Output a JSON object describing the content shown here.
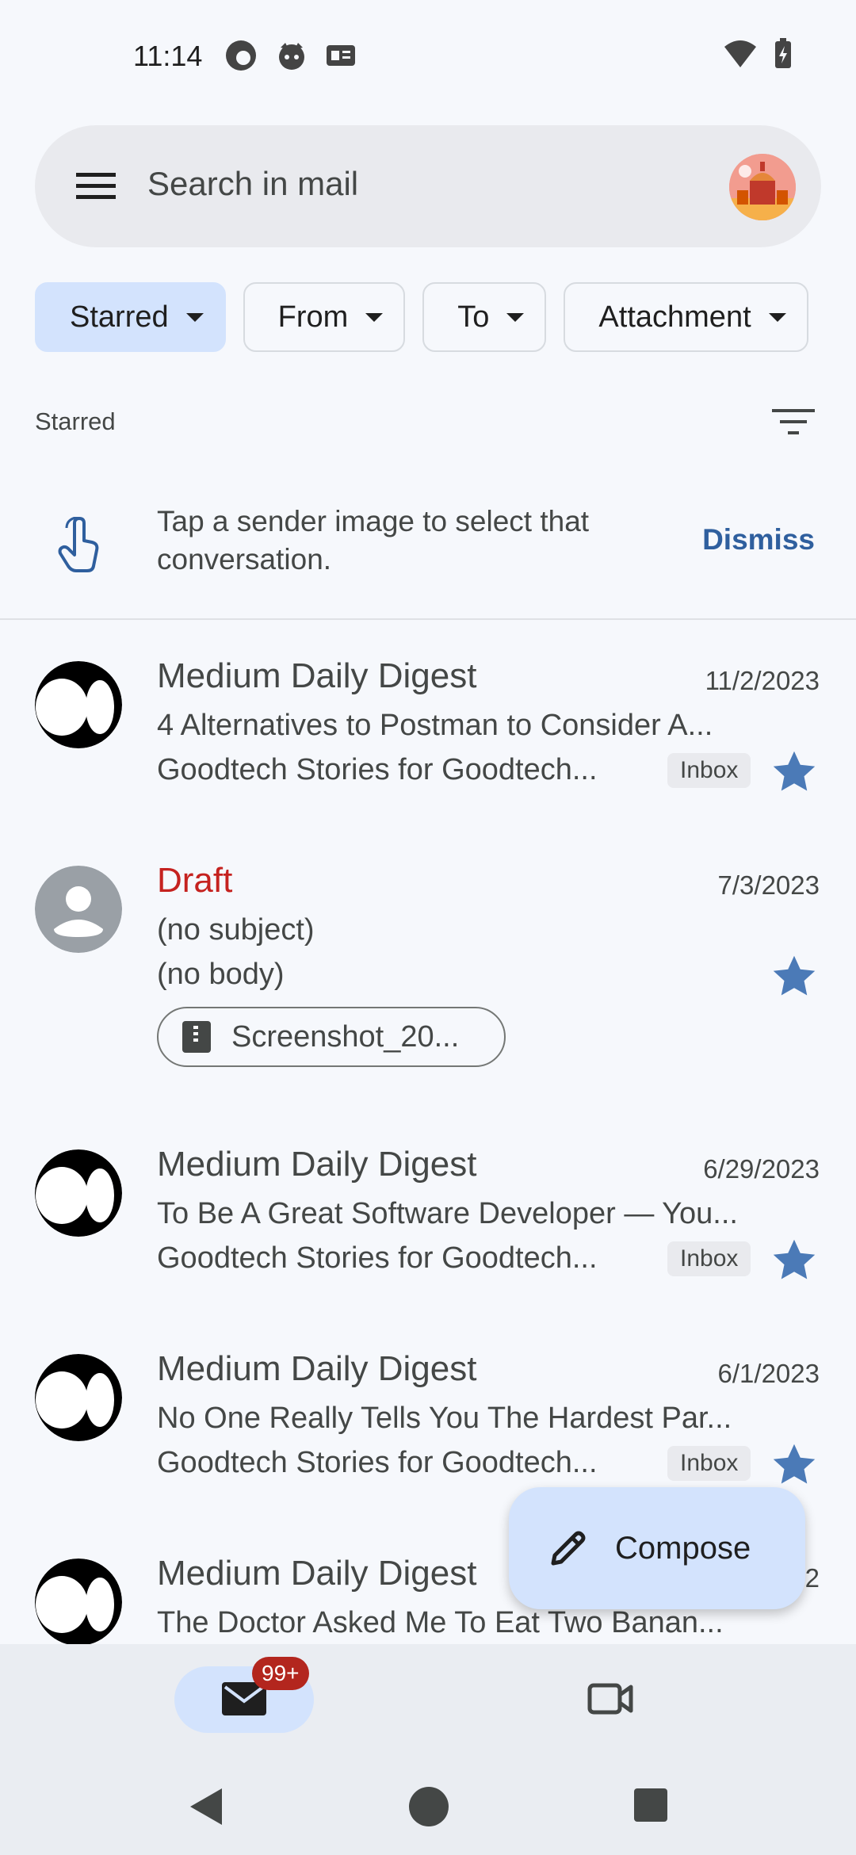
{
  "status": {
    "time": "11:14"
  },
  "search": {
    "placeholder": "Search in mail"
  },
  "chips": [
    {
      "label": "Starred"
    },
    {
      "label": "From"
    },
    {
      "label": "To"
    },
    {
      "label": "Attachment"
    }
  ],
  "section": {
    "label": "Starred"
  },
  "tip": {
    "text": "Tap a sender image to select that conversation.",
    "dismiss": "Dismiss"
  },
  "mails": [
    {
      "sender": "Medium Daily Digest",
      "date": "11/2/2023",
      "subject": "4 Alternatives to Postman to Consider A...",
      "snippet": "Goodtech Stories for Goodtech...",
      "label": "Inbox"
    },
    {
      "sender": "Draft",
      "date": "7/3/2023",
      "subject": "(no subject)",
      "snippet": "(no body)",
      "attachment": "Screenshot_20..."
    },
    {
      "sender": "Medium Daily Digest",
      "date": "6/29/2023",
      "subject": "To Be A Great Software Developer — You...",
      "snippet": "Goodtech Stories for Goodtech...",
      "label": "Inbox"
    },
    {
      "sender": "Medium Daily Digest",
      "date": "6/1/2023",
      "subject": "No One Really Tells You The Hardest Par...",
      "snippet": "Goodtech Stories for Goodtech...",
      "label": "Inbox"
    },
    {
      "sender": "Medium Daily Digest",
      "date": "…22",
      "subject": "The Doctor Asked Me To Eat Two Banan..."
    }
  ],
  "compose": {
    "label": "Compose"
  },
  "nav": {
    "mail_badge": "99+"
  },
  "colors": {
    "accent": "#d3e3fd",
    "star": "#4b7ab7",
    "draft": "#c5221f",
    "badge": "#b3261e"
  }
}
